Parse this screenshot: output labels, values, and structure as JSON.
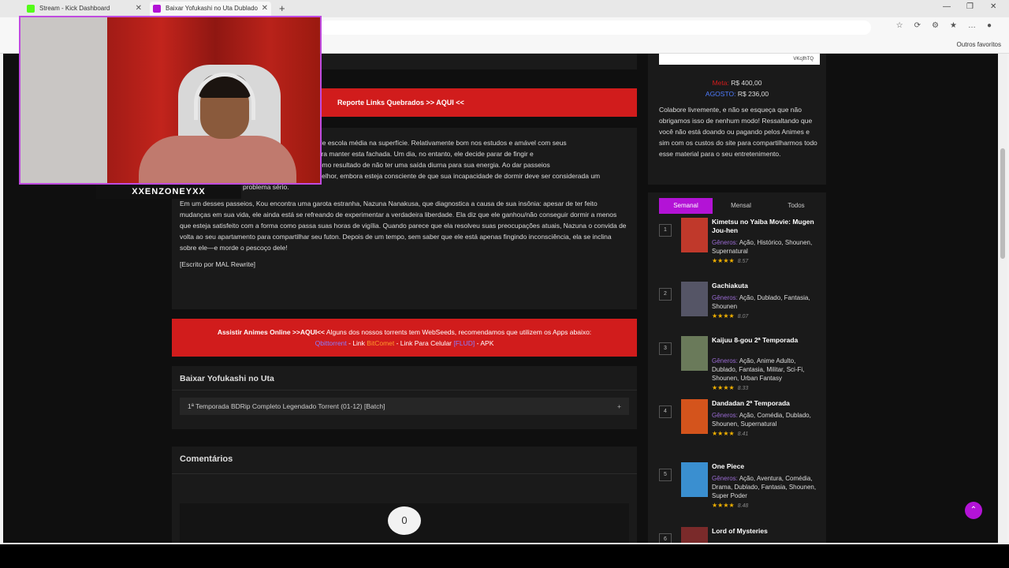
{
  "browser": {
    "tabs": [
      {
        "title": "Stream - Kick Dashboard",
        "favicon_color": "#53fc18"
      },
      {
        "title": "Baixar Yofukashi no Uta Dublado",
        "favicon_color": "#b313d6"
      }
    ],
    "new_tab": "+",
    "favorites_other": "Outros favoritos"
  },
  "stream": {
    "streamer_name": "XXENZONEYXX"
  },
  "page": {
    "report_link": "Reporte Links Quebrados >> AQUI <<",
    "synopsis": [
      "de escola média na superfície. Relativamente bom nos estudos e amável com seus",
      "para manter esta fachada. Um dia, no entanto, ele decide parar de fingir e",
      ", desenvolvendo insônia como resultado de não ter uma saída diurna para sua energia. Ao dar passeios",
      "se sente marginalmente melhor, embora esteja consciente de que sua incapacidade de dormir deve ser considerada um problema sério.",
      "Em um desses passeios, Kou encontra uma garota estranha, Nazuna Nanakusa, que diagnostica a causa de sua insônia: apesar de ter feito mudanças em sua vida, ele ainda está se refreando de experimentar a verdadeira liberdade. Ela diz que ele ganhou/não conseguir dormir a menos que esteja satisfeito com a forma como passa suas horas de vigília. Quando parece que ela resolveu suas preocupações atuais, Nazuna o convida de volta ao seu apartamento para compartilhar seu futon. Depois de um tempo, sem saber que ele está apenas fingindo inconsciência, ela se inclina sobre ele—e morde o pescoço dele!",
      "[Escrito por MAL Rewrite]"
    ],
    "assist": {
      "bold": "Assistir Animes Online >>AQUI<<",
      "text": " Alguns dos nossos torrents tem WebSeeds, recomendamos que utilizem os Apps abaixo:",
      "app1": "Qbittorrent",
      "sep1": " - Link ",
      "app2": "BitComet",
      "sep2": " - Link Para Celular ",
      "app3": "[FLUD]",
      "sep3": " - APK"
    },
    "download": {
      "title": "Baixar Yofukashi no Uta",
      "item": "1ª Temporada BDRip Completo Legendado Torrent (01-12) [Batch]",
      "plus": "+"
    },
    "comments": {
      "title": "Comentários",
      "count": "0"
    }
  },
  "sidebar": {
    "qr_caption": "VKcjfhTQ",
    "meta_label": "Meta:",
    "meta_value": "R$ 400,00",
    "agosto_label": "AGOSTO:",
    "agosto_value": "R$ 236,00",
    "collab_text": "Colabore livremente, e não se esqueça que não obrigamos isso de nenhum modo! Ressaltando que você não está doando ou pagando pelos Animes e sim com os custos do site para compartilharmos todo esse material para o seu entretenimento.",
    "tabs": [
      "Semanal",
      "Mensal",
      "Todos"
    ],
    "ranking": [
      {
        "num": "1",
        "title": "Kimetsu no Yaiba Movie: Mugen Jou-hen",
        "genres": "Ação, Histórico, Shounen, Supernatural",
        "score": "8.57",
        "stars": 4
      },
      {
        "num": "2",
        "title": "Gachiakuta",
        "genres": "Ação, Dublado, Fantasia, Shounen",
        "score": "8.07",
        "stars": 4
      },
      {
        "num": "3",
        "title": "Kaijuu 8-gou 2ª Temporada",
        "genres": "Ação, Anime Adulto, Dublado, Fantasia, Militar, Sci-Fi, Shounen, Urban Fantasy",
        "score": "8.33",
        "stars": 4
      },
      {
        "num": "4",
        "title": "Dandadan 2ª Temporada",
        "genres": "Ação, Comédia, Dublado, Shounen, Supernatural",
        "score": "8.41",
        "stars": 4
      },
      {
        "num": "5",
        "title": "One Piece",
        "genres": "Ação, Aventura, Comédia, Drama, Dublado, Fantasia, Shounen, Super Poder",
        "score": "8.48",
        "stars": 4
      },
      {
        "num": "6",
        "title": "Lord of Mysteries",
        "genres": "",
        "score": "",
        "stars": 0
      }
    ],
    "genre_label": "Gêneros:",
    "star_glyph": "★"
  }
}
